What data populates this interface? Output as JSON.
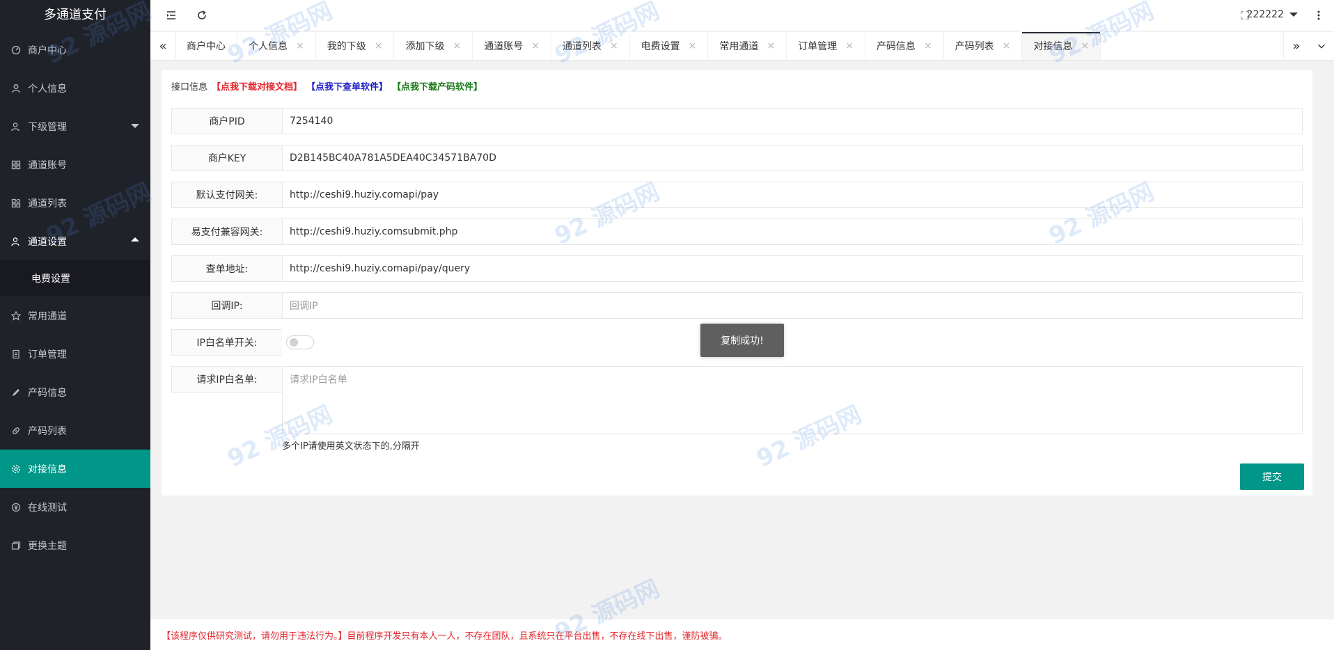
{
  "app": {
    "title": "多通道支付"
  },
  "sidebar": {
    "items": [
      {
        "label": "商户中心",
        "icon": "dashboard-icon"
      },
      {
        "label": "个人信息",
        "icon": "user-icon"
      },
      {
        "label": "下级管理",
        "icon": "users-icon"
      },
      {
        "label": "通道账号",
        "icon": "grid-icon"
      },
      {
        "label": "通道列表",
        "icon": "apps-icon"
      },
      {
        "label": "通道设置",
        "icon": "user-settings-icon"
      },
      {
        "label": "电费设置"
      },
      {
        "label": "常用通道",
        "icon": "star-icon"
      },
      {
        "label": "订单管理",
        "icon": "document-icon"
      },
      {
        "label": "产码信息",
        "icon": "pencil-icon"
      },
      {
        "label": "产码列表",
        "icon": "link-icon"
      },
      {
        "label": "对接信息",
        "icon": "gear-icon"
      },
      {
        "label": "在线测试",
        "icon": "yen-icon"
      },
      {
        "label": "更换主题",
        "icon": "theme-icon"
      }
    ]
  },
  "header": {
    "username": "222222"
  },
  "tabs": [
    {
      "label": "商户中心"
    },
    {
      "label": "个人信息"
    },
    {
      "label": "我的下级"
    },
    {
      "label": "添加下级"
    },
    {
      "label": "通道账号"
    },
    {
      "label": "通道列表"
    },
    {
      "label": "电费设置"
    },
    {
      "label": "常用通道"
    },
    {
      "label": "订单管理"
    },
    {
      "label": "产码信息"
    },
    {
      "label": "产码列表"
    },
    {
      "label": "对接信息"
    }
  ],
  "content": {
    "head_label": "接口信息",
    "link_docs": "【点我下载对接文档】",
    "link_query": "【点我下查单软件】",
    "link_code": "【点我下载产码软件】",
    "fields": {
      "pid": {
        "label": "商户PID",
        "value": "7254140"
      },
      "key": {
        "label": "商户KEY",
        "value": "D2B145BC40A781A5DEA40C34571BA70D"
      },
      "gateway": {
        "label": "默认支付网关:",
        "value": "http://ceshi9.huziy.comapi/pay"
      },
      "epay": {
        "label": "易支付兼容网关:",
        "value": "http://ceshi9.huziy.comsubmit.php"
      },
      "query": {
        "label": "查单地址:",
        "value": "http://ceshi9.huziy.comapi/pay/query"
      },
      "callback": {
        "label": "回调IP:",
        "placeholder": "回调IP"
      },
      "ip_switch": {
        "label": "IP白名单开关:"
      },
      "ip_whitelist": {
        "label": "请求IP白名单:",
        "placeholder": "请求IP白名单"
      }
    },
    "tip": "多个IP请使用英文状态下的,分隔开",
    "submit": "提交",
    "toast": "复制成功!"
  },
  "footer": {
    "text": "【该程序仅供研究测试，请勿用于违法行为。】目前程序开发只有本人一人，不存在团队，且系统只在平台出售，不存在线下出售，谨防被骗。"
  },
  "watermark": {
    "text": "92 源码网",
    "url": "www.92luntan.com"
  },
  "colors": {
    "sidebar_bg": "#20222a",
    "accent": "#009688",
    "link_red": "#e4262c",
    "link_blue": "#1e1ec8",
    "link_green": "#1a7a1a"
  }
}
